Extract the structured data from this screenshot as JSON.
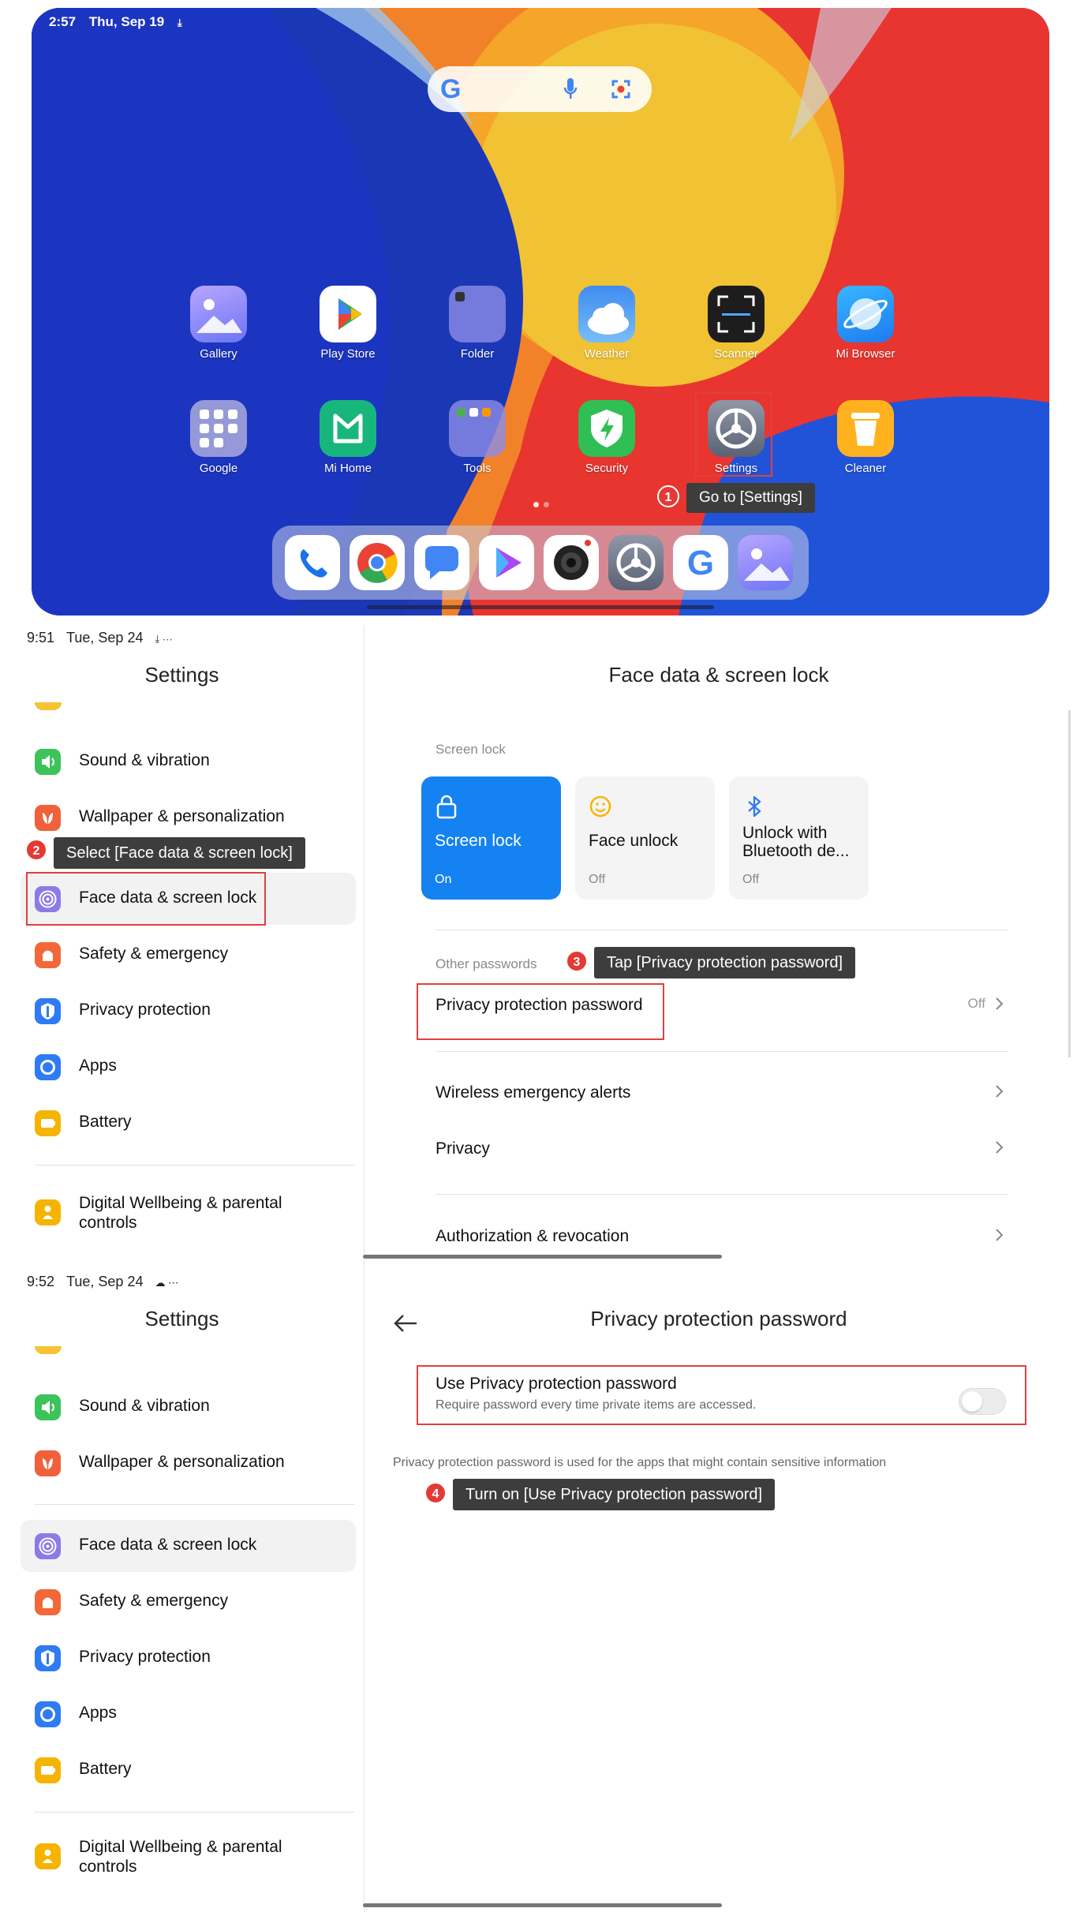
{
  "home": {
    "status_time": "2:57",
    "status_date": "Thu, Sep 19",
    "search_logo": "G",
    "apps_row1": [
      "Gallery",
      "Play Store",
      "Folder",
      "Weather",
      "Scanner",
      "Mi Browser"
    ],
    "apps_row2": [
      "Google",
      "Mi Home",
      "Tools",
      "Security",
      "Settings",
      "Cleaner"
    ],
    "dock_icons": [
      "phone-icon",
      "chrome-icon",
      "messages-icon",
      "play-games-icon",
      "camera-icon",
      "settings-icon",
      "google-icon",
      "gallery-icon"
    ],
    "step1_number": "1",
    "step1_tip": "Go to [Settings]"
  },
  "settings_list": {
    "title": "Settings",
    "items": [
      {
        "label": "Sound & vibration",
        "icon": "sound-icon",
        "color": "#3cc35a"
      },
      {
        "label": "Wallpaper & personalization",
        "icon": "wallpaper-icon",
        "color": "#f0603a"
      },
      {
        "label": "Face data & screen lock",
        "icon": "face-lock-icon",
        "color": "#8b7be8"
      },
      {
        "label": "Safety & emergency",
        "icon": "safety-icon",
        "color": "#f26838"
      },
      {
        "label": "Privacy protection",
        "icon": "privacy-icon",
        "color": "#2f7af5"
      },
      {
        "label": "Apps",
        "icon": "apps-icon",
        "color": "#2f7af5"
      },
      {
        "label": "Battery",
        "icon": "battery-icon",
        "color": "#f5b400"
      },
      {
        "label": "Digital Wellbeing & parental controls",
        "icon": "wellbeing-icon",
        "color": "#f5b400"
      }
    ]
  },
  "panel2": {
    "status_time": "9:51",
    "status_date": "Tue, Sep 24",
    "title": "Face data & screen lock",
    "screen_lock_label": "Screen lock",
    "cards": [
      {
        "title": "Screen lock",
        "state": "On"
      },
      {
        "title": "Face unlock",
        "state": "Off"
      },
      {
        "title": "Unlock with Bluetooth de...",
        "state": "Off"
      }
    ],
    "other_passwords_label": "Other passwords",
    "privacy_password": {
      "label": "Privacy protection password",
      "value": "Off"
    },
    "rows": [
      "Wireless emergency alerts",
      "Privacy",
      "Authorization & revocation"
    ],
    "step2_number": "2",
    "step2_tip": "Select [Face data & screen lock]",
    "step3_number": "3",
    "step3_tip": "Tap [Privacy protection password]"
  },
  "panel3": {
    "status_time": "9:52",
    "status_date": "Tue, Sep 24",
    "title": "Privacy protection password",
    "toggle_title": "Use Privacy protection password",
    "toggle_subtitle": "Require password every time private items are accessed.",
    "toggle_state": "off",
    "footnote": "Privacy protection password is used for the apps that might contain sensitive information",
    "step4_number": "4",
    "step4_tip": "Turn on [Use Privacy protection password]"
  },
  "colors": {
    "highlight": "#e0403f",
    "accent": "#1482f0",
    "tooltip": "#3d3d3d"
  }
}
